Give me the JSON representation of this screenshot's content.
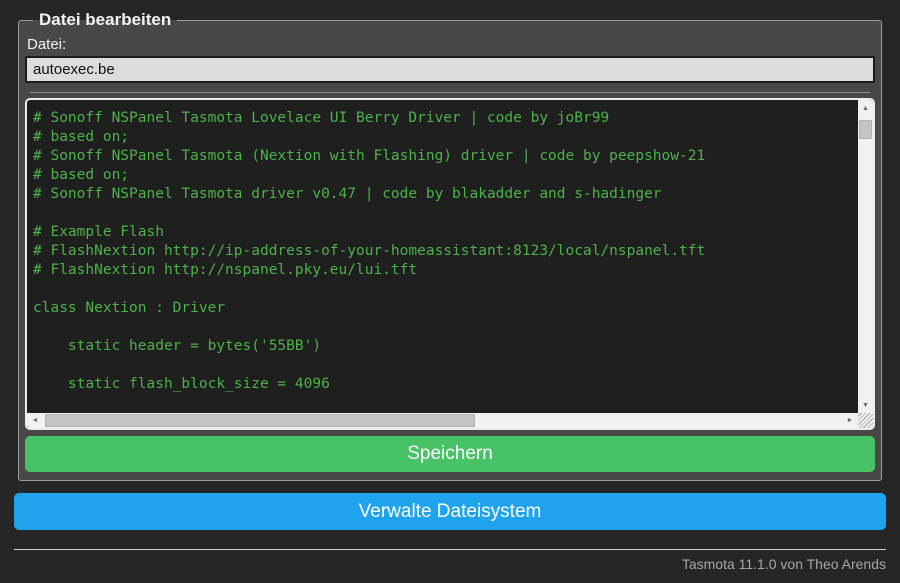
{
  "editor_form": {
    "legend": "Datei bearbeiten",
    "file_label": "Datei:",
    "file_input_value": "autoexec.be",
    "save_button_label": "Speichern"
  },
  "code_editor": {
    "lines": [
      "# Sonoff NSPanel Tasmota Lovelace UI Berry Driver | code by joBr99",
      "# based on;",
      "# Sonoff NSPanel Tasmota (Nextion with Flashing) driver | code by peepshow-21",
      "# based on;",
      "# Sonoff NSPanel Tasmota driver v0.47 | code by blakadder and s-hadinger",
      "",
      "# Example Flash",
      "# FlashNextion http://ip-address-of-your-homeassistant:8123/local/nspanel.tft",
      "# FlashNextion http://nspanel.pky.eu/lui.tft",
      "",
      "class Nextion : Driver",
      "",
      "    static header = bytes('55BB')",
      "",
      "    static flash_block_size = 4096",
      ""
    ]
  },
  "scrollbar": {
    "up_icon": "▲",
    "down_icon": "▼",
    "left_icon": "◄",
    "right_icon": "►"
  },
  "buttons": {
    "manage_filesystem_label": "Verwalte Dateisystem"
  },
  "footer": {
    "text": "Tasmota 11.1.0 von Theo Arends"
  },
  "colors": {
    "page_background": "#262626",
    "panel_background": "#484848",
    "panel_border": "#9c9c9c",
    "input_background": "#dcdcdc",
    "console_background": "#1f1f1f",
    "console_text": "#4db14a",
    "save_button": "#47c266",
    "action_button": "#1fa3ec",
    "button_text": "#fdffff",
    "footer_text": "#a6a6a6"
  }
}
